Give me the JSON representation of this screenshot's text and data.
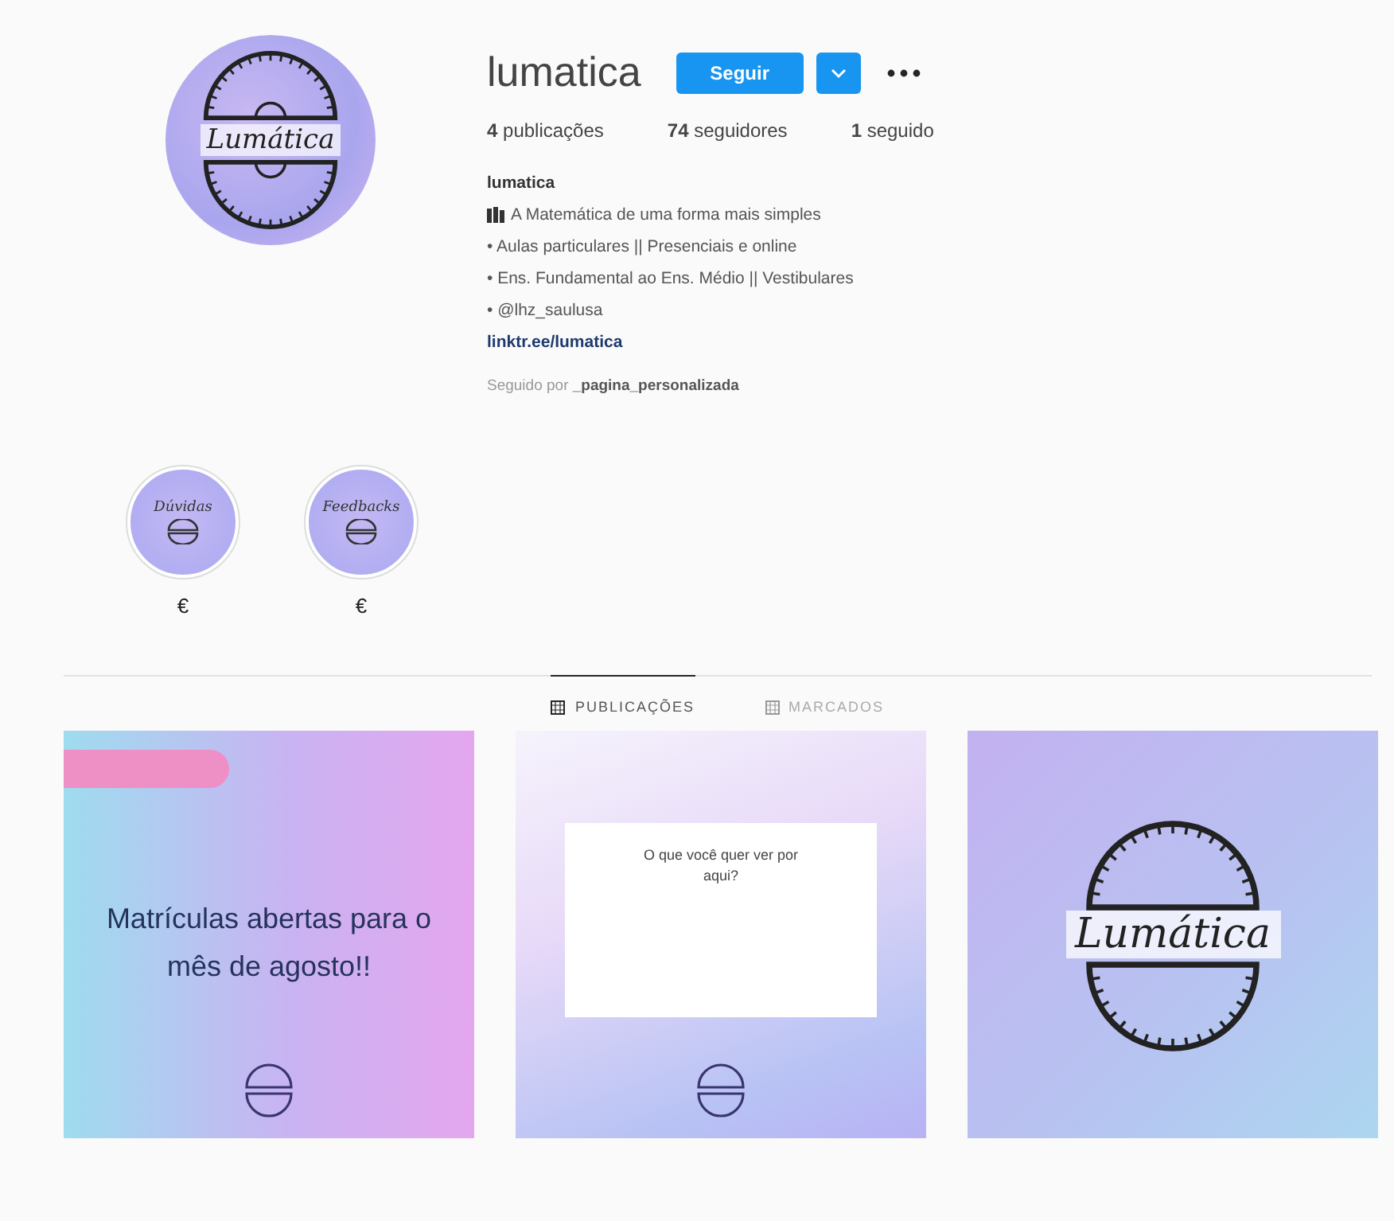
{
  "profile": {
    "logo_text": "Lumática",
    "username": "lumatica",
    "follow_button": "Seguir",
    "stats": [
      {
        "value": "4",
        "label": "publicações"
      },
      {
        "value": "74",
        "label": "seguidores"
      },
      {
        "value": "1",
        "label": "seguido"
      }
    ],
    "name": "lumatica",
    "bio": [
      "A Matemática de uma forma mais simples",
      "• Aulas particulares || Presenciais e online",
      "• Ens. Fundamental ao Ens. Médio || Vestibulares",
      "• @lhz_saulusa"
    ],
    "link": "linktr.ee/lumatica",
    "followed_by": "Seguido por",
    "followed_by_user": "_pagina_personalizada"
  },
  "highlights": [
    {
      "cover_text": "Dúvidas",
      "label": "€"
    },
    {
      "cover_text": "Feedbacks",
      "label": "€"
    }
  ],
  "tabs": [
    {
      "label": "PUBLICAÇÕES",
      "selected": true
    },
    {
      "label": "MARCADOS",
      "selected": false
    }
  ],
  "posts": [
    {
      "kind": "announcement",
      "text": "Matrículas abertas para o mês de agosto!!"
    },
    {
      "kind": "question",
      "text": "O que você quer ver por aqui?"
    },
    {
      "kind": "logo",
      "text": "Lumática"
    }
  ]
}
